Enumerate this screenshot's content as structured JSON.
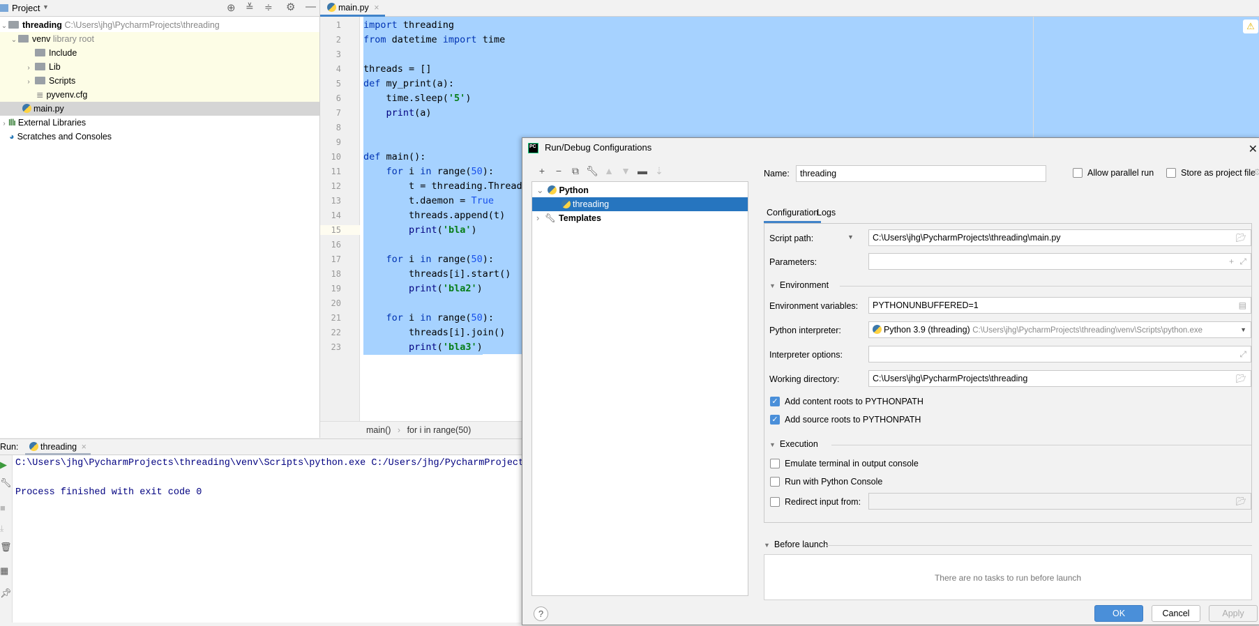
{
  "project_panel": {
    "title": "Project",
    "toolbar_icons": [
      "locate-icon",
      "expand-all-icon",
      "collapse-all-icon",
      "gear-icon",
      "minimize-icon"
    ],
    "tree": [
      {
        "name": "threading",
        "hint": "C:\\Users\\jhg\\PycharmProjects\\threading",
        "type": "folder",
        "expanded": true
      },
      {
        "name": "venv",
        "hint": "library root",
        "type": "folder",
        "expanded": true
      },
      {
        "name": "Include",
        "type": "folder"
      },
      {
        "name": "Lib",
        "type": "folder",
        "expanded": false
      },
      {
        "name": "Scripts",
        "type": "folder",
        "expanded": false
      },
      {
        "name": "pyvenv.cfg",
        "type": "file"
      },
      {
        "name": "main.py",
        "type": "python-file",
        "selected": true
      },
      {
        "name": "External Libraries",
        "type": "libraries"
      },
      {
        "name": "Scratches and Consoles",
        "type": "scratches"
      }
    ]
  },
  "editor": {
    "tab": "main.py",
    "lines": [
      "import threading",
      "from datetime import time",
      "",
      "threads = []",
      "def my_print(a):",
      "    time.sleep('5')",
      "    print(a)",
      "",
      "",
      "def main():",
      "    for i in range(50):",
      "        t = threading.Thread(",
      "        t.daemon = True",
      "        threads.append(t)",
      "        print('bla')",
      "",
      "    for i in range(50):",
      "        threads[i].start()",
      "        print('bla2')",
      "",
      "    for i in range(50):",
      "        threads[i].join()",
      "        print('bla3')"
    ],
    "current_line": 15,
    "breadcrumbs": [
      "main()",
      "for i in range(50)"
    ],
    "warning_icon": "warning-icon"
  },
  "run_panel": {
    "label": "Run:",
    "tab": "threading",
    "console": [
      "C:\\Users\\jhg\\PycharmProjects\\threading\\venv\\Scripts\\python.exe C:/Users/jhg/PycharmProjects",
      "",
      "Process finished with exit code 0"
    ]
  },
  "dialog": {
    "title": "Run/Debug Configurations",
    "logo": "PC",
    "tree": [
      {
        "label": "Python",
        "bold": true,
        "expanded": true
      },
      {
        "label": "threading",
        "selected": true
      },
      {
        "label": "Templates",
        "bold": true,
        "expanded": false
      }
    ],
    "name_label": "Name:",
    "name_value": "threading",
    "allow_parallel_run": {
      "label": "Allow parallel run",
      "checked": false
    },
    "store_as_project_file": {
      "label": "Store as project file",
      "checked": false
    },
    "tabs": [
      "Configuration",
      "Logs"
    ],
    "active_tab": "Configuration",
    "script_path_label": "Script path:",
    "script_path_value": "C:\\Users\\jhg\\PycharmProjects\\threading\\main.py",
    "parameters_label": "Parameters:",
    "parameters_value": "",
    "environment_section": "Environment",
    "env_vars_label": "Environment variables:",
    "env_vars_value": "PYTHONUNBUFFERED=1",
    "interpreter_label": "Python interpreter:",
    "interpreter_name": "Python 3.9 (threading)",
    "interpreter_path": "C:\\Users\\jhg\\PycharmProjects\\threading\\venv\\Scripts\\python.exe",
    "interpreter_options_label": "Interpreter options:",
    "interpreter_options_value": "",
    "working_dir_label": "Working directory:",
    "working_dir_value": "C:\\Users\\jhg\\PycharmProjects\\threading",
    "add_content_roots": {
      "label": "Add content roots to PYTHONPATH",
      "checked": true
    },
    "add_source_roots": {
      "label": "Add source roots to PYTHONPATH",
      "checked": true
    },
    "execution_section": "Execution",
    "emulate_terminal": {
      "label": "Emulate terminal in output console",
      "checked": false
    },
    "run_with_console": {
      "label": "Run with Python Console",
      "checked": false
    },
    "redirect_input": {
      "label": "Redirect input from:",
      "checked": false,
      "value": ""
    },
    "before_launch_section": "Before launch",
    "before_launch_empty": "There are no tasks to run before launch",
    "buttons": {
      "ok": "OK",
      "cancel": "Cancel",
      "apply": "Apply",
      "help": "?"
    }
  }
}
